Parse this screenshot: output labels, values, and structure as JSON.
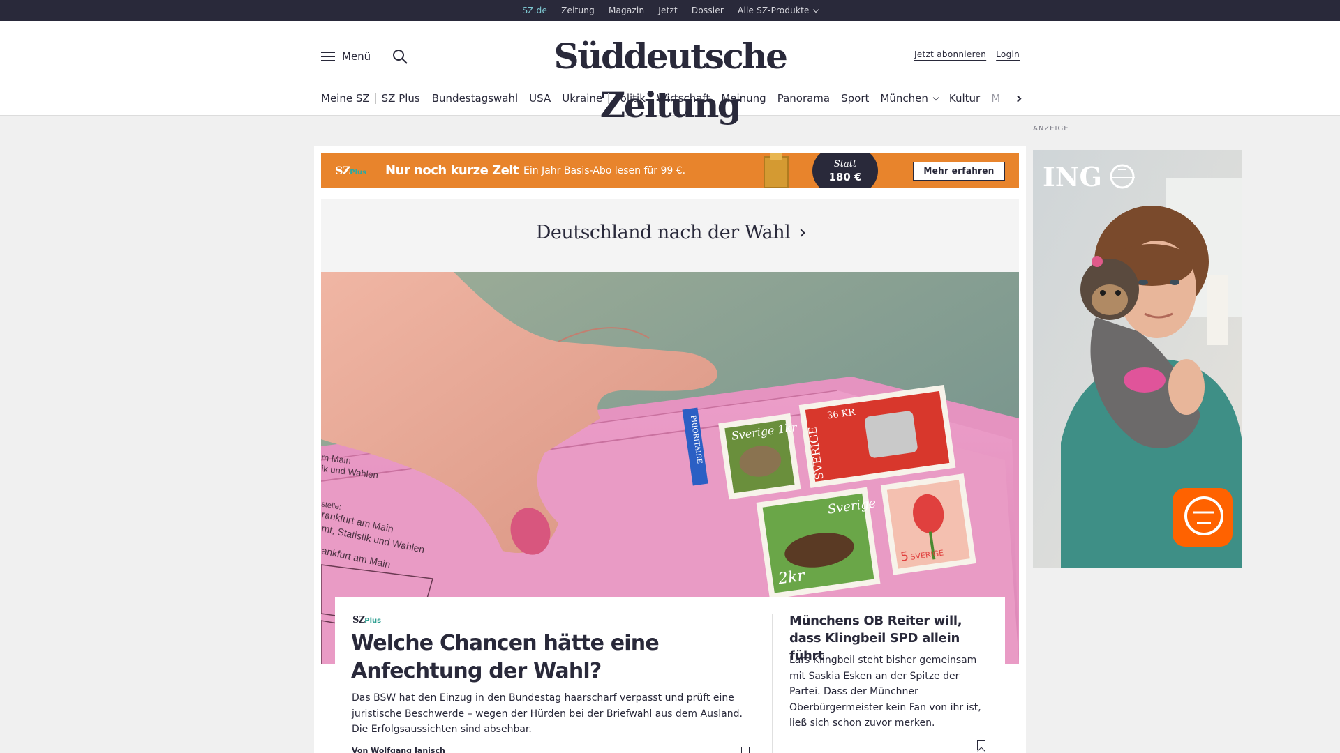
{
  "topbar": {
    "items": [
      "SZ.de",
      "Zeitung",
      "Magazin",
      "Jetzt",
      "Dossier",
      "Alle SZ-Produkte"
    ]
  },
  "header": {
    "menu_label": "Menü",
    "logo": "Süddeutsche Zeitung",
    "subscribe": "Jetzt abonnieren",
    "login": "Login"
  },
  "nav": {
    "items": [
      "Meine SZ",
      "SZ Plus",
      "Bundestagswahl",
      "USA",
      "Ukraine",
      "Politik",
      "Wirtschaft",
      "Meinung",
      "Panorama",
      "Sport",
      "München",
      "Kultur",
      "M"
    ]
  },
  "promo": {
    "logo": "SZ",
    "logo_plus": "Plus",
    "headline": "Nur noch kurze Zeit",
    "text": "Ein Jahr Basis-Abo lesen für 99 €.",
    "badge_statt": "Statt",
    "badge_price": "180 €",
    "cta": "Mehr erfahren"
  },
  "section": {
    "title": "Deutschland nach der Wahl"
  },
  "hero_image": {
    "envelope_text": [
      "m Main",
      "ik und Wahlen",
      "stelle:",
      "rankfurt am Main",
      "mt, Statistik und Wahlen",
      "ankfurt am Main"
    ],
    "stamps": [
      "PRIORITAIRE",
      "Sverige 1kr",
      "SVERIGE",
      "36 KR",
      "Sverige",
      "2kr",
      "5",
      "SVERIGE"
    ]
  },
  "lead_article": {
    "tag": "SZ",
    "tag_plus": "Plus",
    "headline": "Welche Chancen hätte eine Anfechtung der Wahl?",
    "text": "Das BSW hat den Einzug in den Bundestag haarscharf verpasst und prüft eine juristische Beschwerde – wegen der Hürden bei der Briefwahl aus dem Ausland. Die Erfolgsaussichten sind absehbar.",
    "author": "Von Wolfgang Janisch"
  },
  "side_article": {
    "headline": "Münchens OB Reiter will, dass Klingbeil SPD allein führt",
    "text": "Lars Klingbeil steht bisher gemeinsam mit Saskia Esken an der Spitze der Partei. Dass der Münchner Oberbürgermeister kein Fan von ihr ist, ließ sich schon zuvor merken."
  },
  "ad": {
    "label": "ANZEIGE",
    "brand": "ING"
  },
  "colors": {
    "topbar": "#29293a",
    "accent_active": "#7ec8d2",
    "promo": "#e8842c",
    "sz_plus": "#2a9d8f",
    "ing_orange": "#ff6200"
  }
}
